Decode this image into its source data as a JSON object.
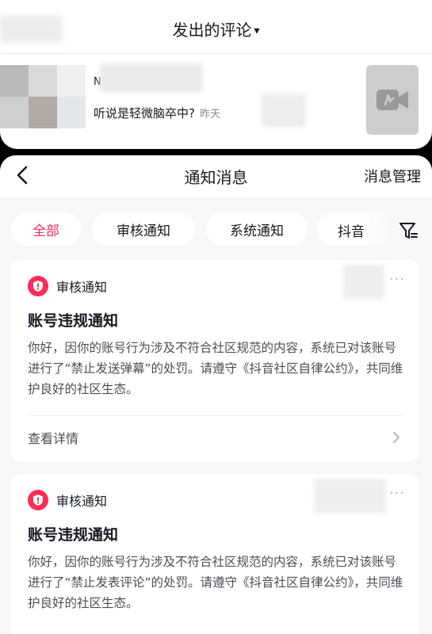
{
  "top": {
    "title": "发出的评论",
    "caret": "▾",
    "comment_name_initial": "N",
    "comment_text": "听说是轻微脑卒中?",
    "comment_time": "昨天"
  },
  "nav": {
    "title": "通知消息",
    "right_action": "消息管理"
  },
  "tabs": {
    "all": "全部",
    "review": "审核通知",
    "system": "系统通知",
    "douyin": "抖音"
  },
  "cards": [
    {
      "type": "审核通知",
      "title": "账号违规通知",
      "body": "你好，因你的账号行为涉及不符合社区规范的内容，系统已对该账号进行了“禁止发送弹幕”的处罚。请遵守《抖音社区自律公约》，共同维护良好的社区生态。",
      "detail": "查看详情",
      "more": "···"
    },
    {
      "type": "审核通知",
      "title": "账号违规通知",
      "body": "你好，因你的账号行为涉及不符合社区规范的内容，系统已对该账号进行了“禁止发表评论”的处罚。请遵守《抖音社区自律公约》，共同维护良好的社区生态。",
      "more": "···"
    }
  ],
  "colors": {
    "accent": "#fe2c55",
    "background": "#f7f7f7"
  }
}
